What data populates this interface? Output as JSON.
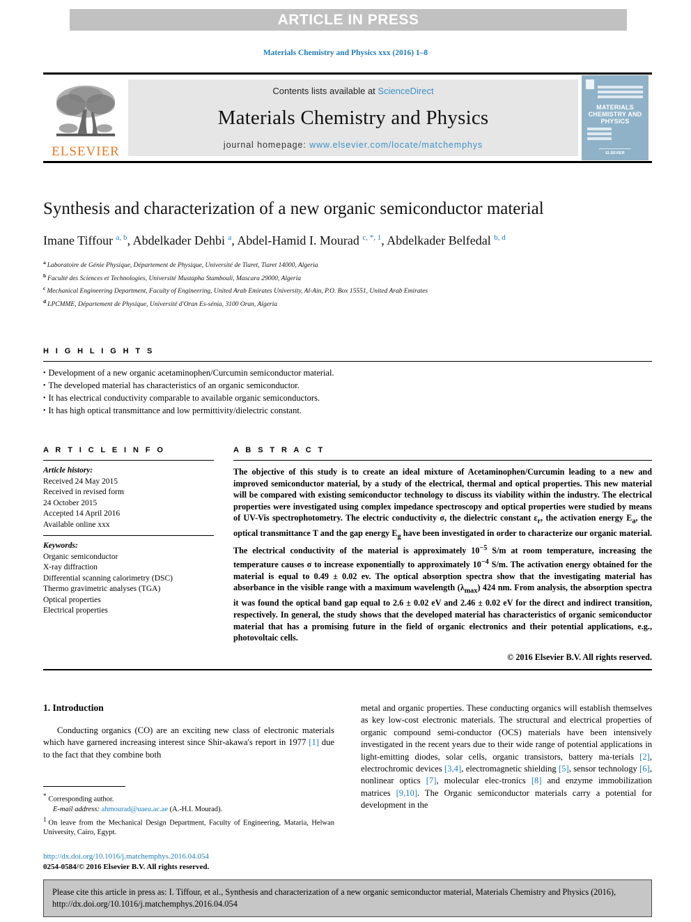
{
  "banner": {
    "text": "ARTICLE IN PRESS"
  },
  "running_head": "Materials Chemistry and Physics xxx (2016) 1–8",
  "masthead": {
    "publisher_name": "ELSEVIER",
    "contents_prefix": "Contents lists available at ",
    "contents_link": "ScienceDirect",
    "journal_title": "Materials Chemistry and Physics",
    "homepage_prefix": "journal homepage: ",
    "homepage_url": "www.elsevier.com/locate/matchemphys",
    "cover": {
      "title_line1": "MATERIALS",
      "title_line2": "CHEMISTRY AND",
      "title_line3": "PHYSICS",
      "subtitle": "A journal devoted to innovative research in materials chemistry and physics",
      "footer": "ELSEVIER"
    },
    "accent_color": "#3a92c6",
    "elsevier_orange": "#e87722"
  },
  "article": {
    "title": "Synthesis and characterization of a new organic semiconductor material",
    "authors_html": "Imane Tiffour <sup class=\"aff-mark\">a, b</sup>, Abdelkader Dehbi <sup class=\"aff-mark\">a</sup>, Abdel-Hamid I. Mourad <sup class=\"aff-mark\">c, *, 1</sup>, Abdelkader Belfedal <sup class=\"aff-mark\">b, d</sup>",
    "affiliations": [
      {
        "mark": "a",
        "text": "Laboratoire de Génie Physique, Département de Physique, Université de Tiaret, Tiaret 14000, Algeria"
      },
      {
        "mark": "b",
        "text": "Faculté des Sciences et Technologies, Université Mustapha Stambouli, Mascara 29000, Algeria"
      },
      {
        "mark": "c",
        "text": "Mechanical Engineering Department, Faculty of Engineering, United Arab Emirates University, Al-Ain, P.O. Box 15551, United Arab Emirates"
      },
      {
        "mark": "d",
        "text": "LPCMME, Département de Physique, Université d'Oran Es-sénia, 3100 Oran, Algeria"
      }
    ]
  },
  "highlights": {
    "heading": "H I G H L I G H T S",
    "items": [
      "Development of a new organic acetaminophen/Curcumin semiconductor material.",
      "The developed material has characteristics of an organic semiconductor.",
      "It has electrical conductivity comparable to available organic semiconductors.",
      "It has high optical transmittance and low permittivity/dielectric constant."
    ]
  },
  "article_info": {
    "heading": "A R T I C L E  I N F O",
    "history_label": "Article history:",
    "history_lines": [
      "Received 24 May 2015",
      "Received in revised form",
      "24 October 2015",
      "Accepted 14 April 2016",
      "Available online xxx"
    ],
    "keywords_label": "Keywords:",
    "keywords": [
      "Organic semiconductor",
      "X-ray diffraction",
      "Differential scanning calorimetry (DSC)",
      "Thermo gravimetric analyses (TGA)",
      "Optical properties",
      "Electrical properties"
    ]
  },
  "abstract": {
    "heading": "A B S T R A C T",
    "body_html": "The objective of this study is to create an ideal mixture of Acetaminophen/Curcumin leading to a new and improved semiconductor material, by a study of the electrical, thermal and optical properties. This new material will be compared with existing semiconductor technology to discuss its viability within the industry. The electrical properties were investigated using complex impedance spectroscopy and optical properties were studied by means of UV-Vis spectrophotometry. The electric conductivity &sigma;, the dielectric constant &epsilon;<sub>r</sub>, the activation energy E<sub>a</sub>, the optical transmittance T and the gap energy E<sub>g</sub> have been investigated in order to characterize our organic material. The electrical conductivity of the material is approximately 10<sup>&minus;5</sup> S/m at room temperature, increasing the temperature causes &sigma; to increase exponentially to approximately 10<sup>&minus;4</sup> S/m. The activation energy obtained for the material is equal to 0.49 &plusmn; 0.02 ev. The optical absorption spectra show that the investigating material has absorbance in the visible range with a maximum wavelength (&lambda;<sub>max</sub>) 424 nm. From analysis, the absorption spectra it was found the optical band gap equal to 2.6 &plusmn; 0.02 eV and 2.46 &plusmn; 0.02 eV for the direct and indirect transition, respectively. In general, the study shows that the developed material has characteristics of organic semiconductor material that has a promising future in the field of organic electronics and their potential applications, e.g., photovoltaic cells.",
    "copyright": "© 2016 Elsevier B.V. All rights reserved."
  },
  "introduction": {
    "section_number_title": "1.  Introduction",
    "left_paragraph_html": "Conducting organics (CO) are an exciting new class of electronic materials which have garnered increasing interest since Shir-akawa's report in 1977 <span class=\"ref\">[1]</span> due to the fact that they combine both",
    "right_paragraph_html": "metal and organic properties. These conducting organics will establish themselves as key low-cost electronic materials. The structural and electrical properties of organic compound semi-conductor (OCS) materials have been intensively investigated in the recent years due to their wide range of potential applications in light-emitting diodes, solar cells, organic transistors, battery ma-terials <span class=\"ref\">[2]</span>, electrochromic devices <span class=\"ref\">[3,4]</span>, electromagnetic shielding <span class=\"ref\">[5]</span>, sensor technology <span class=\"ref\">[6]</span>, nonlinear optics <span class=\"ref\">[7]</span>, molecular elec-tronics <span class=\"ref\">[8]</span> and enzyme immobilization matrices <span class=\"ref\">[9,10]</span>. The Organic semiconductor materials carry a potential for development in the"
  },
  "footnotes": {
    "corresponding_author": "Corresponding author.",
    "email_label": "E-mail address:",
    "email": "ahmourad@uaeu.ac.ae",
    "email_suffix": "(A.-H.I. Mourad).",
    "on_leave": "On leave from the Mechanical Design Department, Faculty of Engineering, Mataria, Helwan University, Cairo, Egypt."
  },
  "doi": {
    "url": "http://dx.doi.org/10.1016/j.matchemphys.2016.04.054",
    "issn_line": "0254-0584/© 2016 Elsevier B.V. All rights reserved."
  },
  "cite_box": {
    "text": "Please cite this article in press as: I. Tiffour, et al., Synthesis and characterization of a new organic semiconductor material, Materials Chemistry and Physics (2016), http://dx.doi.org/10.1016/j.matchemphys.2016.04.054"
  }
}
